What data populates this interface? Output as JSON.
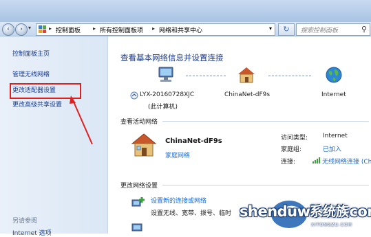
{
  "breadcrumb": {
    "items": [
      "控制面板",
      "所有控制面板项",
      "网络和共享中心"
    ]
  },
  "search": {
    "placeholder": "搜索控制面板"
  },
  "sidebar": {
    "items": [
      {
        "label": "控制面板主页"
      },
      {
        "label": "管理无线网络"
      },
      {
        "label": "更改适配器设置"
      },
      {
        "label": "更改高级共享设置"
      }
    ],
    "see_also_title": "另请参阅",
    "see_also_partial": "Internet 选项"
  },
  "main": {
    "heading": "查看基本网络信息并设置连接",
    "map": {
      "computer_name": "LYX-20160728XJC",
      "computer_sub": "(此计算机)",
      "network_name": "ChinaNet-dF9s",
      "internet_label": "Internet"
    },
    "active_title": "查看活动网络",
    "active_network": {
      "name": "ChinaNet-dF9s",
      "type": "家庭网络",
      "access_type_label": "访问类型:",
      "access_type_value": "Internet",
      "homegroup_label": "家庭组:",
      "homegroup_value": "已加入",
      "connection_label": "连接:",
      "connection_value": "无线网络连接 (Ch"
    },
    "change_title": "更改网络设置",
    "change_link": "设置新的连接或网络",
    "change_desc": "设置无线、宽带、拨号、临时"
  },
  "watermark": {
    "text": "shenduwin10.com",
    "cn": "系统族",
    "sub": "XITONGZU.COM"
  },
  "colors": {
    "link": "#1a6bd6",
    "heading": "#1e3a8a",
    "highlight": "#e02020"
  }
}
